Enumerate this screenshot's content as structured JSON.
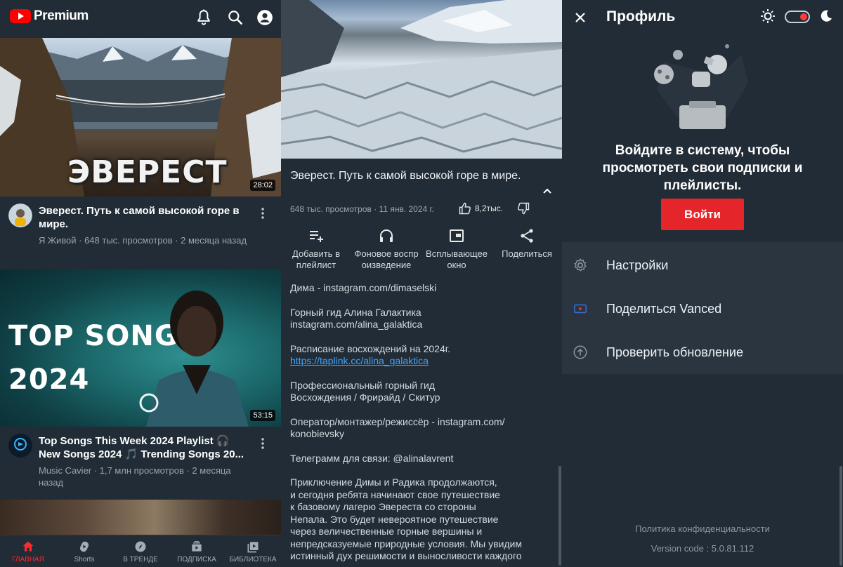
{
  "home": {
    "logo_text": "Premium",
    "videos": [
      {
        "thumb_text": "ЭВЕРЕСТ",
        "duration": "28:02",
        "title": "Эверест. Путь к самой высокой горе в мире.",
        "subtitle": "Я Живой · 648 тыс. просмотров · 2 месяца назад"
      },
      {
        "thumb_text": "TOP SONGS\n2024",
        "duration": "53:15",
        "title": "Top Songs This Week 2024 Playlist 🎧 New Songs 2024 🎵 Trending Songs 20...",
        "subtitle": "Music Cavier · 1,7 млн просмотров · 2 месяца назад"
      }
    ],
    "nav": [
      {
        "label": "ГЛАВНАЯ",
        "icon": "home-icon",
        "active": true
      },
      {
        "label": "Shorts",
        "icon": "shorts-icon",
        "active": false
      },
      {
        "label": "В ТРЕНДЕ",
        "icon": "explore-icon",
        "active": false
      },
      {
        "label": "ПОДПИСКА",
        "icon": "subscriptions-icon",
        "active": false
      },
      {
        "label": "БИБЛИОТЕКА",
        "icon": "library-icon",
        "active": false
      }
    ],
    "colors": {
      "accent": "#ff0000",
      "background": "#212c37"
    }
  },
  "video": {
    "title": "Эверест. Путь к самой высокой горе в мире.",
    "stats": "648 тыс. просмотров · 11 янв. 2024 г.",
    "likes": "8,2тыс.",
    "actions": [
      {
        "label": "Добавить в плейлист",
        "icon": "playlist-add-icon"
      },
      {
        "label": "Фоновое воспр оизведение",
        "icon": "headphones-icon"
      },
      {
        "label": "Всплывающее окно",
        "icon": "pip-icon"
      },
      {
        "label": "Поделиться",
        "icon": "share-icon"
      }
    ],
    "description": [
      "Дима - instagram.com/dimaselski",
      "Горный гид Алина Галактика\ninstagram.com/alina_galaktica",
      "Расписание восхождений на 2024г.",
      "Профессиональный горный гид\nВосхождения / Фрирайд / Скитур",
      "Оператор/монтажер/режиссёр - instagram.com/\nkonobievsky",
      "Телеграмм для связи: @alinalavrent",
      "Приключение Димы и Радика продолжаются,\nи сегодня ребята начинают свое путешествие\nк базовому лагерю Эвереста со стороны\nНепала. Это будет невероятное путешествие\nчерез величественные горные вершины и\nнепредсказуемые природные условия. Мы увидим\nистинный дух решимости и выносливости каждого"
    ],
    "link": "https://taplink.cc/alina_galaktica"
  },
  "profile": {
    "title": "Профиль",
    "signin_text": "Войдите в систему, чтобы просмотреть свои подписки и плейлисты.",
    "signin_button": "Войти",
    "menu": [
      {
        "label": "Настройки",
        "icon": "gear-icon"
      },
      {
        "label": "Поделиться Vanced",
        "icon": "vanced-icon"
      },
      {
        "label": "Проверить обновление",
        "icon": "update-icon"
      }
    ],
    "privacy": "Политика конфиденциальности",
    "version": "Version code : 5.0.81.112",
    "toggle_on": true,
    "colors": {
      "button": "#e4262a",
      "link": "#3ea6ff"
    }
  }
}
